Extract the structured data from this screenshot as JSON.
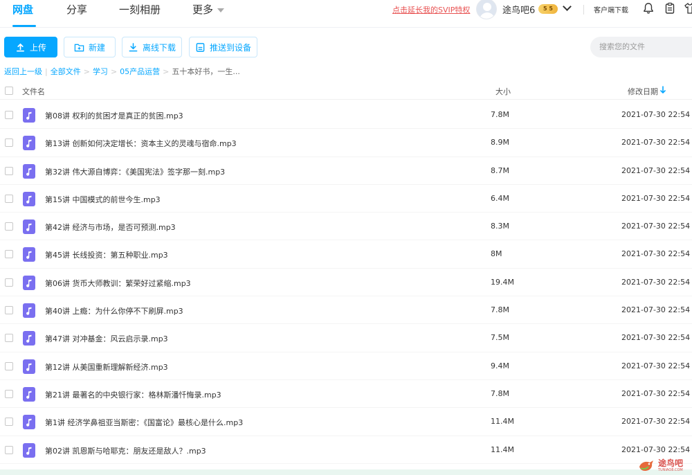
{
  "nav": {
    "tabs": [
      {
        "label": "网盘",
        "active": true
      },
      {
        "label": "分享",
        "active": false
      },
      {
        "label": "一刻相册",
        "active": false
      },
      {
        "label": "更多",
        "active": false
      }
    ],
    "svip_link": "点击延长我的SVIP特权",
    "username": "途鸟吧6",
    "badge": "5  5",
    "client_download": "客户端下载",
    "icons": [
      "bell-icon",
      "clipboard-icon",
      "shirt-icon"
    ],
    "accent_color": "#06a7ff"
  },
  "toolbar": {
    "upload": "上传",
    "new": "新建",
    "offline_download": "离线下载",
    "push_to_device": "推送到设备",
    "search_placeholder": "搜索您的文件"
  },
  "breadcrumb": {
    "back": "返回上一级",
    "items": [
      "全部文件",
      "学习",
      "05产品运营"
    ],
    "current": "五十本好书，一生..."
  },
  "table": {
    "headers": {
      "name": "文件名",
      "size": "大小",
      "date": "修改日期"
    },
    "rows": [
      {
        "name": "第08讲 权利的贫困才是真正的贫困.mp3",
        "size": "7.8M",
        "date": "2021-07-30 22:54"
      },
      {
        "name": "第13讲 创新如何决定增长：资本主义的灵魂与宿命.mp3",
        "size": "8.9M",
        "date": "2021-07-30 22:54"
      },
      {
        "name": "第32讲 伟大源自博弈：《美国宪法》签字那一刻.mp3",
        "size": "8.7M",
        "date": "2021-07-30 22:54"
      },
      {
        "name": "第15讲 中国模式的前世今生.mp3",
        "size": "6.4M",
        "date": "2021-07-30 22:54"
      },
      {
        "name": "第42讲 经济与市场，是否可预测.mp3",
        "size": "8.3M",
        "date": "2021-07-30 22:54"
      },
      {
        "name": "第45讲 长线投资：第五种职业.mp3",
        "size": "8M",
        "date": "2021-07-30 22:54"
      },
      {
        "name": "第06讲 货币大师教训：繁荣好过紧缩.mp3",
        "size": "19.4M",
        "date": "2021-07-30 22:54"
      },
      {
        "name": "第40讲 上瘾：为什么你停不下刷屏.mp3",
        "size": "7.8M",
        "date": "2021-07-30 22:54"
      },
      {
        "name": "第47讲 对冲基金：风云启示录.mp3",
        "size": "7.5M",
        "date": "2021-07-30 22:54"
      },
      {
        "name": "第12讲 从美国重新理解新经济.mp3",
        "size": "9.4M",
        "date": "2021-07-30 22:54"
      },
      {
        "name": "第21讲 最著名的中央银行家：格林斯潘忏悔录.mp3",
        "size": "7.8M",
        "date": "2021-07-30 22:54"
      },
      {
        "name": "第1讲 经济学鼻祖亚当斯密：《国富论》最核心是什么.mp3",
        "size": "11.4M",
        "date": "2021-07-30 22:54"
      },
      {
        "name": "第02讲 凯恩斯与哈耶克：朋友还是敌人？.mp3",
        "size": "11.4M",
        "date": "2021-07-30 22:54"
      }
    ]
  },
  "watermark": {
    "text": "途鸟吧",
    "sub": "TUNIAO8.COM"
  }
}
